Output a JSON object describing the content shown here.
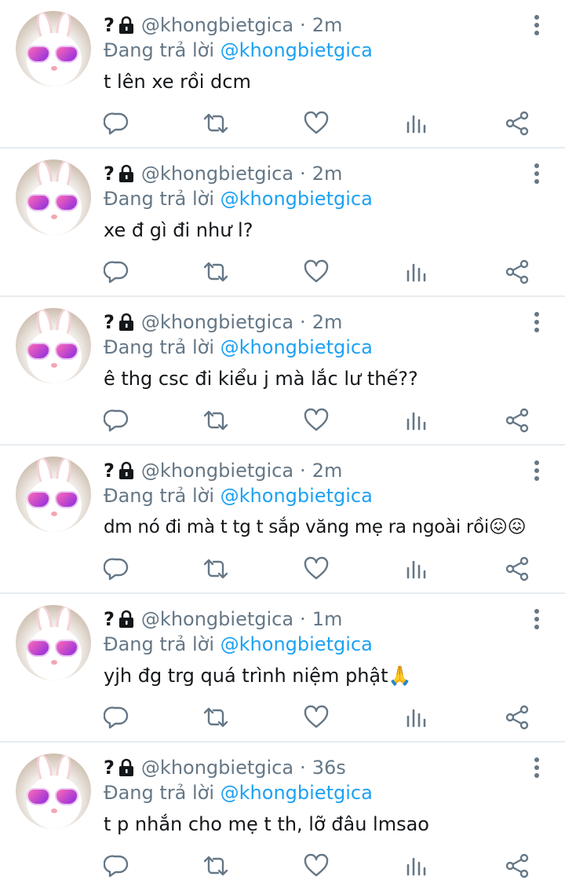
{
  "tweets": [
    {
      "author_mark": "?",
      "handle": "@khongbietgica",
      "time": "2m",
      "reply_prefix": "Đang trả lời",
      "reply_to": "@khongbietgica",
      "text": "t lên xe rồi dcm"
    },
    {
      "author_mark": "?",
      "handle": "@khongbietgica",
      "time": "2m",
      "reply_prefix": "Đang trả lời",
      "reply_to": "@khongbietgica",
      "text": "xe đ gì đi như l?"
    },
    {
      "author_mark": "?",
      "handle": "@khongbietgica",
      "time": "2m",
      "reply_prefix": "Đang trả lời",
      "reply_to": "@khongbietgica",
      "text": "ê thg csc đi kiểu j mà lắc lư thế??"
    },
    {
      "author_mark": "?",
      "handle": "@khongbietgica",
      "time": "2m",
      "reply_prefix": "Đang trả lời",
      "reply_to": "@khongbietgica",
      "text": "dm nó đi mà t tg t sắp văng mẹ ra ngoài rồi😖😖"
    },
    {
      "author_mark": "?",
      "handle": "@khongbietgica",
      "time": "1m",
      "reply_prefix": "Đang trả lời",
      "reply_to": "@khongbietgica",
      "text": "yjh đg trg quá trình niệm phật🙏"
    },
    {
      "author_mark": "?",
      "handle": "@khongbietgica",
      "time": "36s",
      "reply_prefix": "Đang trả lời",
      "reply_to": "@khongbietgica",
      "text": "t p nhắn cho mẹ t th, lỡ đâu lmsao"
    }
  ],
  "separator": "·",
  "icons": [
    "lock-icon",
    "more-vertical-icon",
    "reply-icon",
    "retweet-icon",
    "like-icon",
    "analytics-icon",
    "share-icon"
  ],
  "colors": {
    "mention": "#1da1f2",
    "secondary_text": "#657786",
    "divider": "#e6ecf0"
  }
}
